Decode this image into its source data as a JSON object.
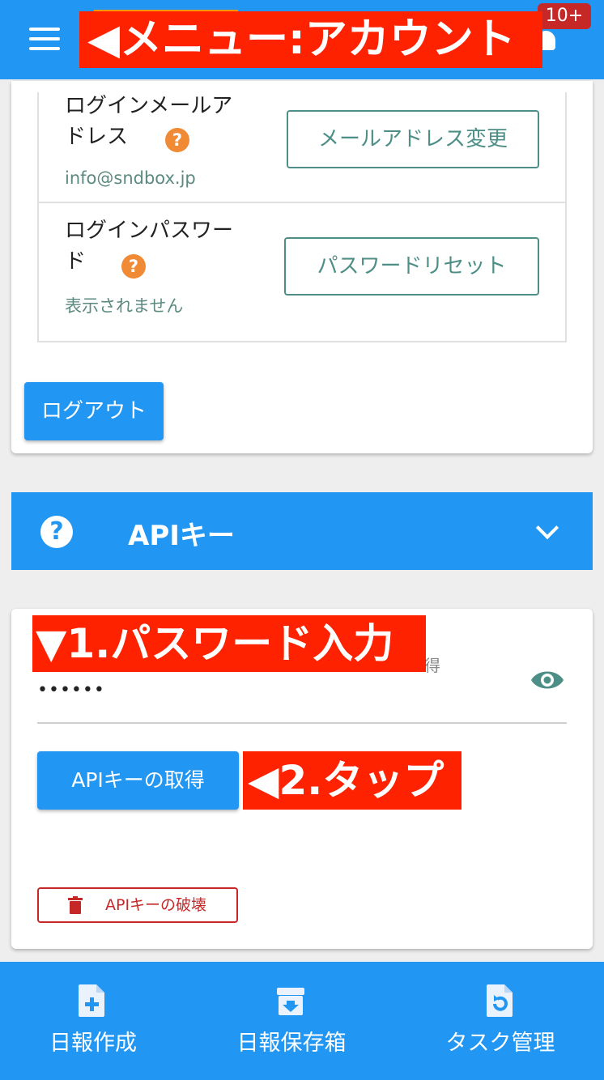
{
  "header": {
    "annotation": "◀メニュー:アカウント",
    "badge": "10+"
  },
  "account": {
    "email_title": "ログインメールアドレス",
    "email_value": "info@sndbox.jp",
    "email_button": "メールアドレス変更",
    "password_title": "ログインパスワード",
    "password_value": "表示されません",
    "password_button": "パスワードリセット",
    "logout_button": "ログアウト"
  },
  "api_section": {
    "title": "APIキー"
  },
  "api_card": {
    "partial_label": "得",
    "annotation_step1": "▼1.パスワード入力",
    "password_masked": "••••••",
    "get_key_button": "APIキーの取得",
    "annotation_step2": "◀2.タップ",
    "destroy_button": "APIキーの破壊"
  },
  "bottom_nav": {
    "items": [
      {
        "label": "日報作成",
        "icon": "file-plus-icon"
      },
      {
        "label": "日報保存箱",
        "icon": "archive-icon"
      },
      {
        "label": "タスク管理",
        "icon": "file-refresh-icon"
      }
    ]
  },
  "colors": {
    "primary": "#2196f3",
    "annotation_red": "#ff2200",
    "teal_text": "#4d8f86",
    "help_orange": "#f08a34",
    "danger": "#c62828"
  }
}
